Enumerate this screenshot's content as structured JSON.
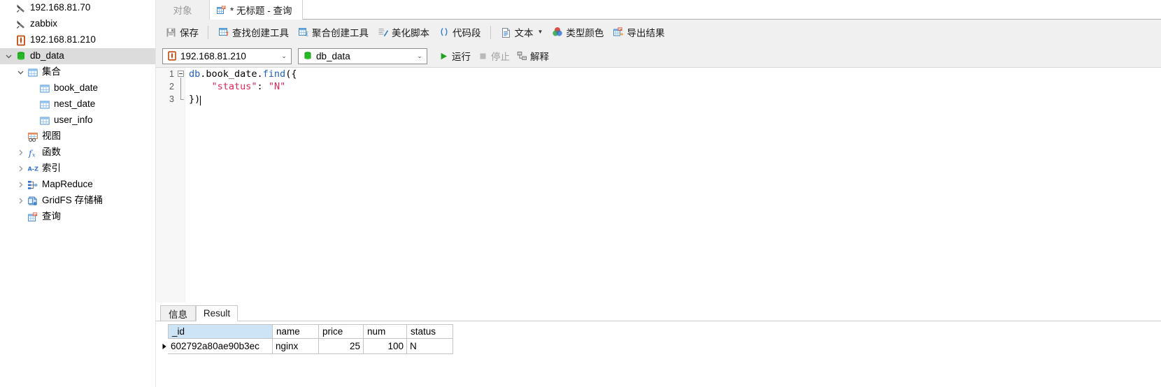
{
  "sidebar": {
    "items": [
      {
        "label": "192.168.81.70",
        "icon": "connection-broken-icon",
        "indent": 0,
        "twisty": "none",
        "selected": false
      },
      {
        "label": "zabbix",
        "icon": "connection-broken-icon",
        "indent": 0,
        "twisty": "none",
        "selected": false
      },
      {
        "label": "192.168.81.210",
        "icon": "mongodb-connection-icon",
        "indent": 0,
        "twisty": "none",
        "selected": false
      },
      {
        "label": "db_data",
        "icon": "database-icon",
        "indent": 0,
        "twisty": "expanded",
        "selected": true
      },
      {
        "label": "集合",
        "icon": "collections-folder-icon",
        "indent": 1,
        "twisty": "expanded",
        "selected": false
      },
      {
        "label": "book_date",
        "icon": "collection-icon",
        "indent": 2,
        "twisty": "none",
        "selected": false
      },
      {
        "label": "nest_date",
        "icon": "collection-icon",
        "indent": 2,
        "twisty": "none",
        "selected": false
      },
      {
        "label": "user_info",
        "icon": "collection-icon",
        "indent": 2,
        "twisty": "none",
        "selected": false
      },
      {
        "label": "视图",
        "icon": "views-icon",
        "indent": 1,
        "twisty": "none",
        "selected": false
      },
      {
        "label": "函数",
        "icon": "functions-icon",
        "indent": 1,
        "twisty": "collapsed",
        "selected": false
      },
      {
        "label": "索引",
        "icon": "indexes-icon",
        "indent": 1,
        "twisty": "collapsed",
        "selected": false
      },
      {
        "label": "MapReduce",
        "icon": "mapreduce-icon",
        "indent": 1,
        "twisty": "collapsed",
        "selected": false
      },
      {
        "label": "GridFS 存储桶",
        "icon": "gridfs-icon",
        "indent": 1,
        "twisty": "collapsed",
        "selected": false
      },
      {
        "label": "查询",
        "icon": "query-icon",
        "indent": 1,
        "twisty": "none",
        "selected": false
      }
    ]
  },
  "tabs": {
    "objects_label": "对象",
    "query_label": "* 无标题 - 查询"
  },
  "toolbar": {
    "save_label": "保存",
    "find_builder_label": "查找创建工具",
    "aggregate_builder_label": "聚合创建工具",
    "beautify_label": "美化脚本",
    "snippet_label": "代码段",
    "text_label": "文本",
    "type_color_label": "类型颜色",
    "export_label": "导出结果"
  },
  "connbar": {
    "connection_value": "192.168.81.210",
    "database_value": "db_data",
    "run_label": "运行",
    "stop_label": "停止",
    "explain_label": "解释"
  },
  "editor": {
    "lines": [
      {
        "number": "1",
        "tokens": [
          {
            "text": "db",
            "type": "kw"
          },
          {
            "text": ".book_date.",
            "type": "plain"
          },
          {
            "text": "find",
            "type": "kw"
          },
          {
            "text": "({",
            "type": "plain"
          }
        ]
      },
      {
        "number": "2",
        "tokens": [
          {
            "text": "    ",
            "type": "plain"
          },
          {
            "text": "\"status\"",
            "type": "str"
          },
          {
            "text": ": ",
            "type": "plain"
          },
          {
            "text": "\"N\"",
            "type": "str"
          }
        ]
      },
      {
        "number": "3",
        "tokens": [
          {
            "text": "})",
            "type": "plain"
          }
        ]
      }
    ]
  },
  "result": {
    "tab_info_label": "信息",
    "tab_result_label": "Result",
    "columns": [
      "_id",
      "name",
      "price",
      "num",
      "status"
    ],
    "rows": [
      {
        "_id": "602792a80ae90b3ec",
        "name": "nginx",
        "price": "25",
        "num": "100",
        "status": "N"
      }
    ]
  },
  "colors": {
    "accent_blue": "#3d85c6",
    "mongo_green": "#13aa52",
    "run_green": "#21a121",
    "string_red": "#e0285a",
    "keyword_blue": "#2060c0",
    "selection_gray": "#dcdcdc",
    "header_highlight": "#cde4f7"
  }
}
